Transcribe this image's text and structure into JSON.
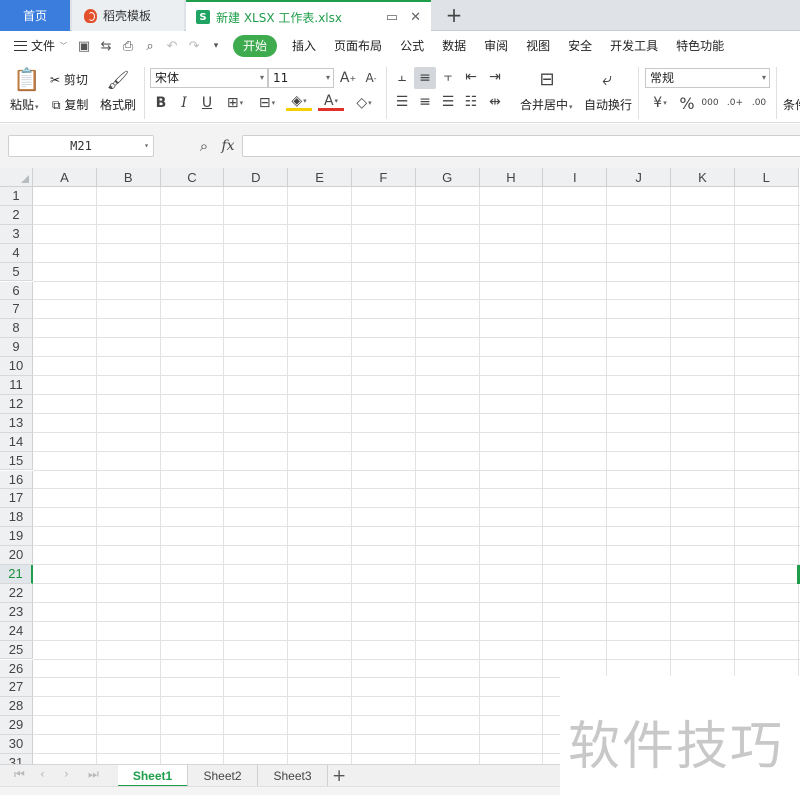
{
  "tabs": {
    "home": "首页",
    "daoke": "稻壳模板",
    "file": "新建 XLSX 工作表.xlsx",
    "new_tab": "+"
  },
  "menu": {
    "file": "文件",
    "items": [
      "开始",
      "插入",
      "页面布局",
      "公式",
      "数据",
      "审阅",
      "视图",
      "安全",
      "开发工具",
      "特色功能"
    ]
  },
  "ribbon": {
    "paste": "粘贴",
    "cut": "剪切",
    "copy": "复制",
    "format_painter": "格式刷",
    "font_name": "宋体",
    "font_size": "11",
    "merge_center": "合并居中",
    "wrap_text": "自动换行",
    "number_format": "常规",
    "conditional": "条件"
  },
  "formula_bar": {
    "name_box": "M21",
    "fx": "fx"
  },
  "grid": {
    "columns": [
      "A",
      "B",
      "C",
      "D",
      "E",
      "F",
      "G",
      "H",
      "I",
      "J",
      "K",
      "L"
    ],
    "rows": [
      "1",
      "2",
      "3",
      "4",
      "5",
      "6",
      "7",
      "8",
      "9",
      "10",
      "11",
      "12",
      "13",
      "14",
      "15",
      "16",
      "17",
      "18",
      "19",
      "20",
      "21",
      "22",
      "23",
      "24",
      "25",
      "26",
      "27",
      "28",
      "29",
      "30",
      "31"
    ],
    "active_row": "21"
  },
  "sheets": [
    "Sheet1",
    "Sheet2",
    "Sheet3"
  ],
  "add_sheet": "+",
  "watermark": "软件技巧",
  "colors": {
    "accent": "#1e9e4a",
    "home_tab": "#3b7ddd",
    "start_pill": "#3fab4f"
  }
}
